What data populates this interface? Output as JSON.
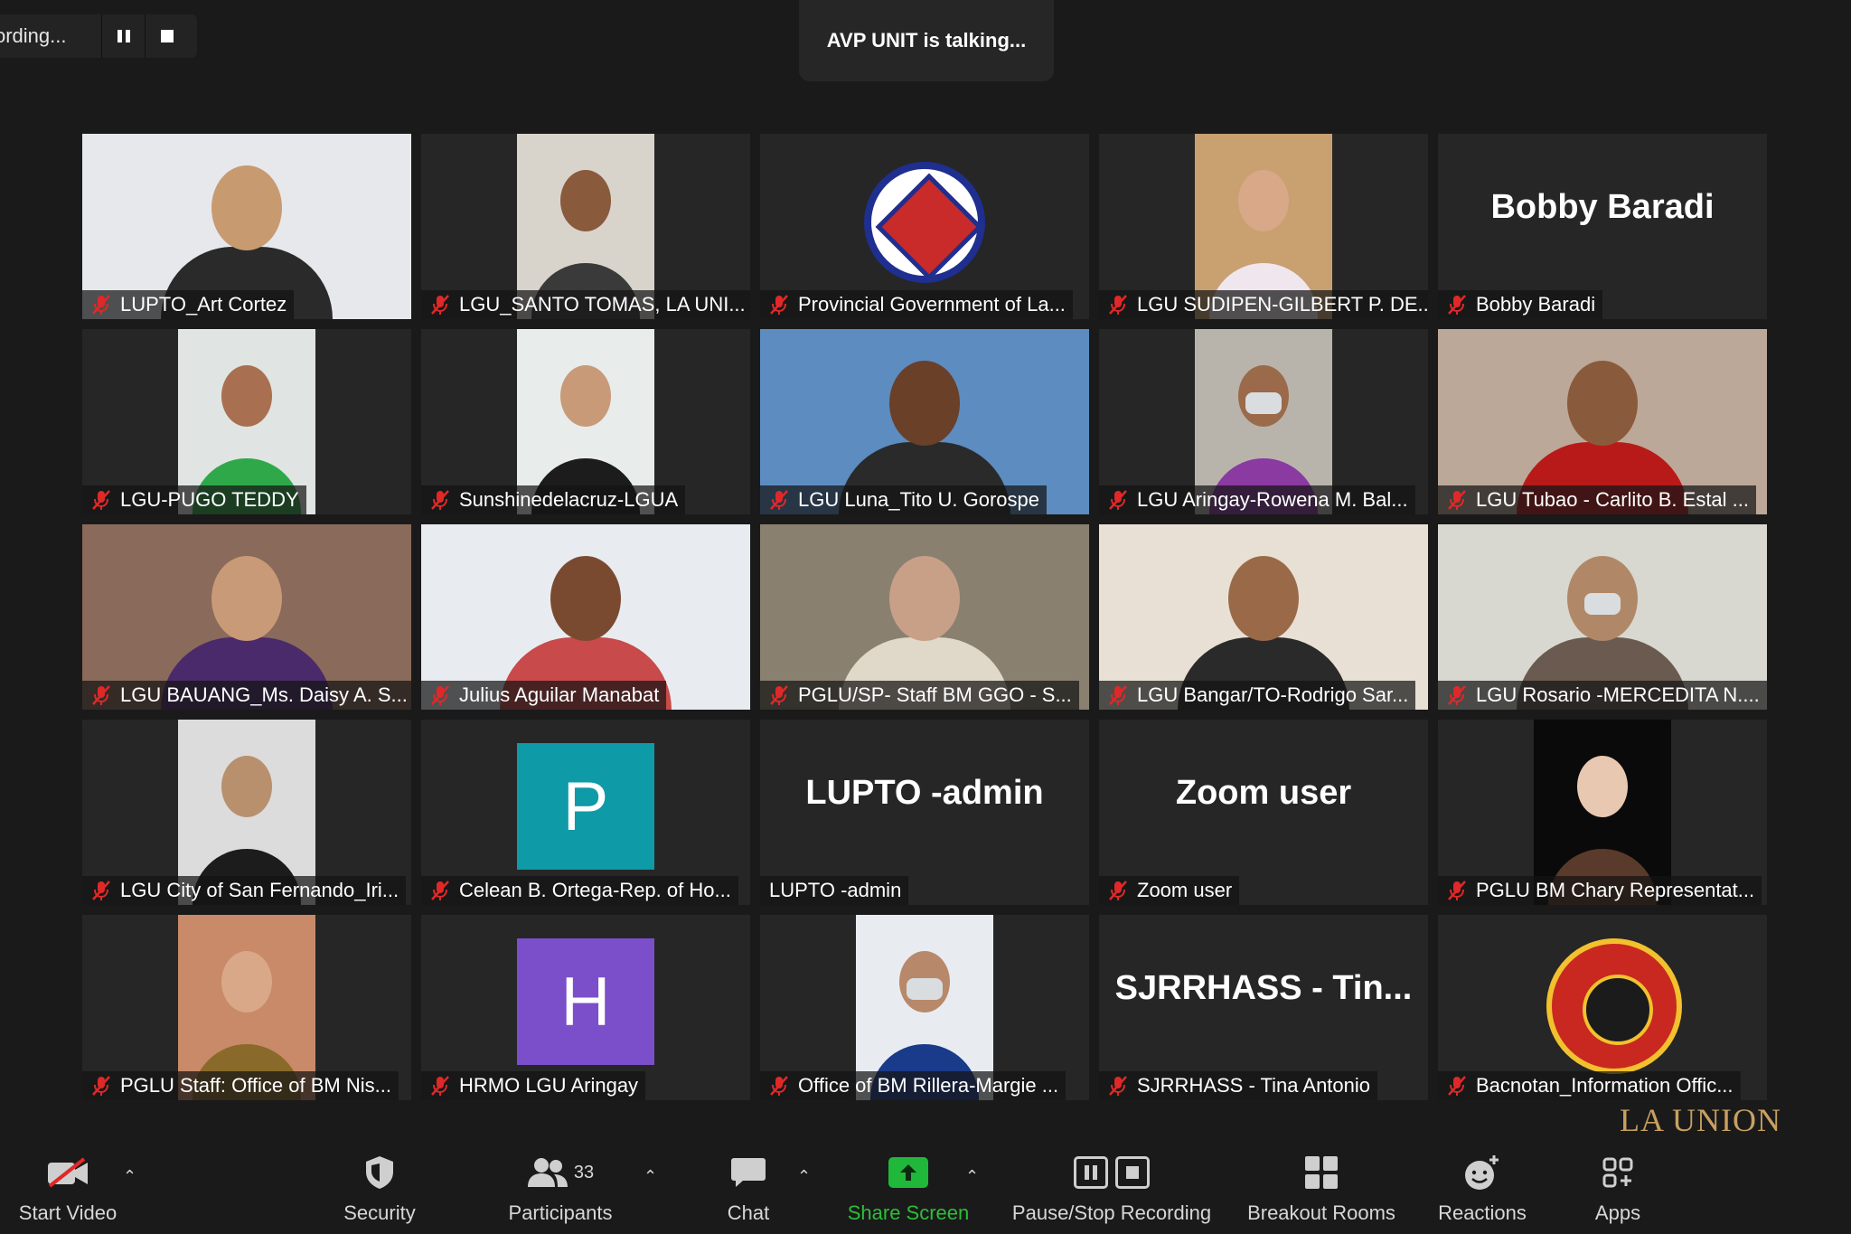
{
  "recording": {
    "text": "ording..."
  },
  "talking_banner": "AVP UNIT is talking...",
  "participants": [
    {
      "label": "LUPTO_Art Cortez",
      "muted": true,
      "kind": "video-wide",
      "bg": "#e6e8ec",
      "skin": "#c89a70",
      "shirt": "#2a2a2a"
    },
    {
      "label": "LGU_SANTO TOMAS, LA UNI...",
      "muted": true,
      "kind": "video",
      "bg": "#d8d4cc",
      "skin": "#8a5a3c",
      "shirt": "#3a3a3a"
    },
    {
      "label": "Provincial Government of La...",
      "muted": true,
      "kind": "seal"
    },
    {
      "label": "LGU SUDIPEN-GILBERT P. DE...",
      "muted": true,
      "kind": "video",
      "bg": "#c9a070",
      "skin": "#d9a888",
      "shirt": "#f0e6ee"
    },
    {
      "label": "Bobby Baradi",
      "muted": true,
      "kind": "name",
      "big": "Bobby Baradi"
    },
    {
      "label": "LGU-PUGO TEDDY",
      "muted": true,
      "kind": "video",
      "bg": "#e0e4e2",
      "skin": "#a87050",
      "shirt": "#2fa84a"
    },
    {
      "label": "Sunshinedelacruz-LGUA",
      "muted": true,
      "kind": "video",
      "bg": "#e8ecea",
      "skin": "#c89a78",
      "shirt": "#1c1c1c"
    },
    {
      "label": "LGU Luna_Tito U. Gorospe",
      "muted": true,
      "kind": "video-wide",
      "bg": "#5c8cc0",
      "skin": "#6a4028",
      "shirt": "#2a2a2a"
    },
    {
      "label": "LGU Aringay-Rowena M. Bal...",
      "muted": true,
      "kind": "video-mask",
      "bg": "#b8b4ac",
      "skin": "#9a6a4a",
      "shirt": "#8a3aa0"
    },
    {
      "label": "LGU Tubao - Carlito B. Estal ...",
      "muted": true,
      "kind": "video-wide",
      "bg": "#bca898",
      "skin": "#8a5a3c",
      "shirt": "#b81a1a"
    },
    {
      "label": "LGU BAUANG_Ms. Daisy A. S...",
      "muted": true,
      "kind": "video-wide",
      "bg": "#8a6a5a",
      "skin": "#c89a78",
      "shirt": "#4a2a6a"
    },
    {
      "label": "Julius Aguilar Manabat",
      "muted": true,
      "kind": "video-wide",
      "bg": "#e8ecf0",
      "skin": "#7a4a30",
      "shirt": "#c84a4a"
    },
    {
      "label": "PGLU/SP- Staff BM GGO - S...",
      "muted": true,
      "kind": "video-wide",
      "bg": "#8a8070",
      "skin": "#c8a088",
      "shirt": "#e0d8c8"
    },
    {
      "label": "LGU Bangar/TO-Rodrigo Sar...",
      "muted": true,
      "kind": "video-wide",
      "bg": "#e8e0d4",
      "skin": "#9a6a48",
      "shirt": "#2a2a2a"
    },
    {
      "label": "LGU Rosario -MERCEDITA N....",
      "muted": true,
      "kind": "video-mask-wide",
      "bg": "#d8d8d0",
      "skin": "#b08868",
      "shirt": "#6a5a50"
    },
    {
      "label": "LGU City of San Fernando_Iri...",
      "muted": true,
      "kind": "video",
      "bg": "#dcdcdc",
      "skin": "#b8906e",
      "shirt": "#1c1c1c"
    },
    {
      "label": "Celean B. Ortega-Rep. of Ho...",
      "muted": true,
      "kind": "avatar",
      "letter": "P",
      "color": "#0e9aa7"
    },
    {
      "label": "LUPTO -admin",
      "muted": false,
      "kind": "name",
      "big": "LUPTO -admin"
    },
    {
      "label": "Zoom user",
      "muted": true,
      "kind": "name",
      "big": "Zoom user"
    },
    {
      "label": "PGLU BM Chary Representat...",
      "muted": true,
      "kind": "video",
      "bg": "#0a0a0a",
      "skin": "#e8c8b0",
      "shirt": "#5a3a2a"
    },
    {
      "label": "PGLU Staff: Office of BM Nis...",
      "muted": true,
      "kind": "video",
      "bg": "#c88a68",
      "skin": "#d8a888",
      "shirt": "#8a6a2a"
    },
    {
      "label": "HRMO LGU Aringay",
      "muted": true,
      "kind": "avatar",
      "letter": "H",
      "color": "#7b4fc9"
    },
    {
      "label": "Office of BM Rillera-Margie ...",
      "muted": true,
      "kind": "video-mask",
      "bg": "#e8ecf0",
      "skin": "#b8886a",
      "shirt": "#1a3a8a"
    },
    {
      "label": "SJRRHASS - Tina Antonio",
      "muted": true,
      "kind": "name",
      "big": "SJRRHASS  -  Tin..."
    },
    {
      "label": "Bacnotan_Information Offic...",
      "muted": true,
      "kind": "logo"
    }
  ],
  "toolbar": {
    "start_video": "Start Video",
    "security": "Security",
    "participants": "Participants",
    "participants_count": "33",
    "chat": "Chat",
    "share_screen": "Share Screen",
    "pause_stop": "Pause/Stop Recording",
    "breakout": "Breakout Rooms",
    "reactions": "Reactions",
    "apps": "Apps"
  },
  "watermark": "LA UNION"
}
